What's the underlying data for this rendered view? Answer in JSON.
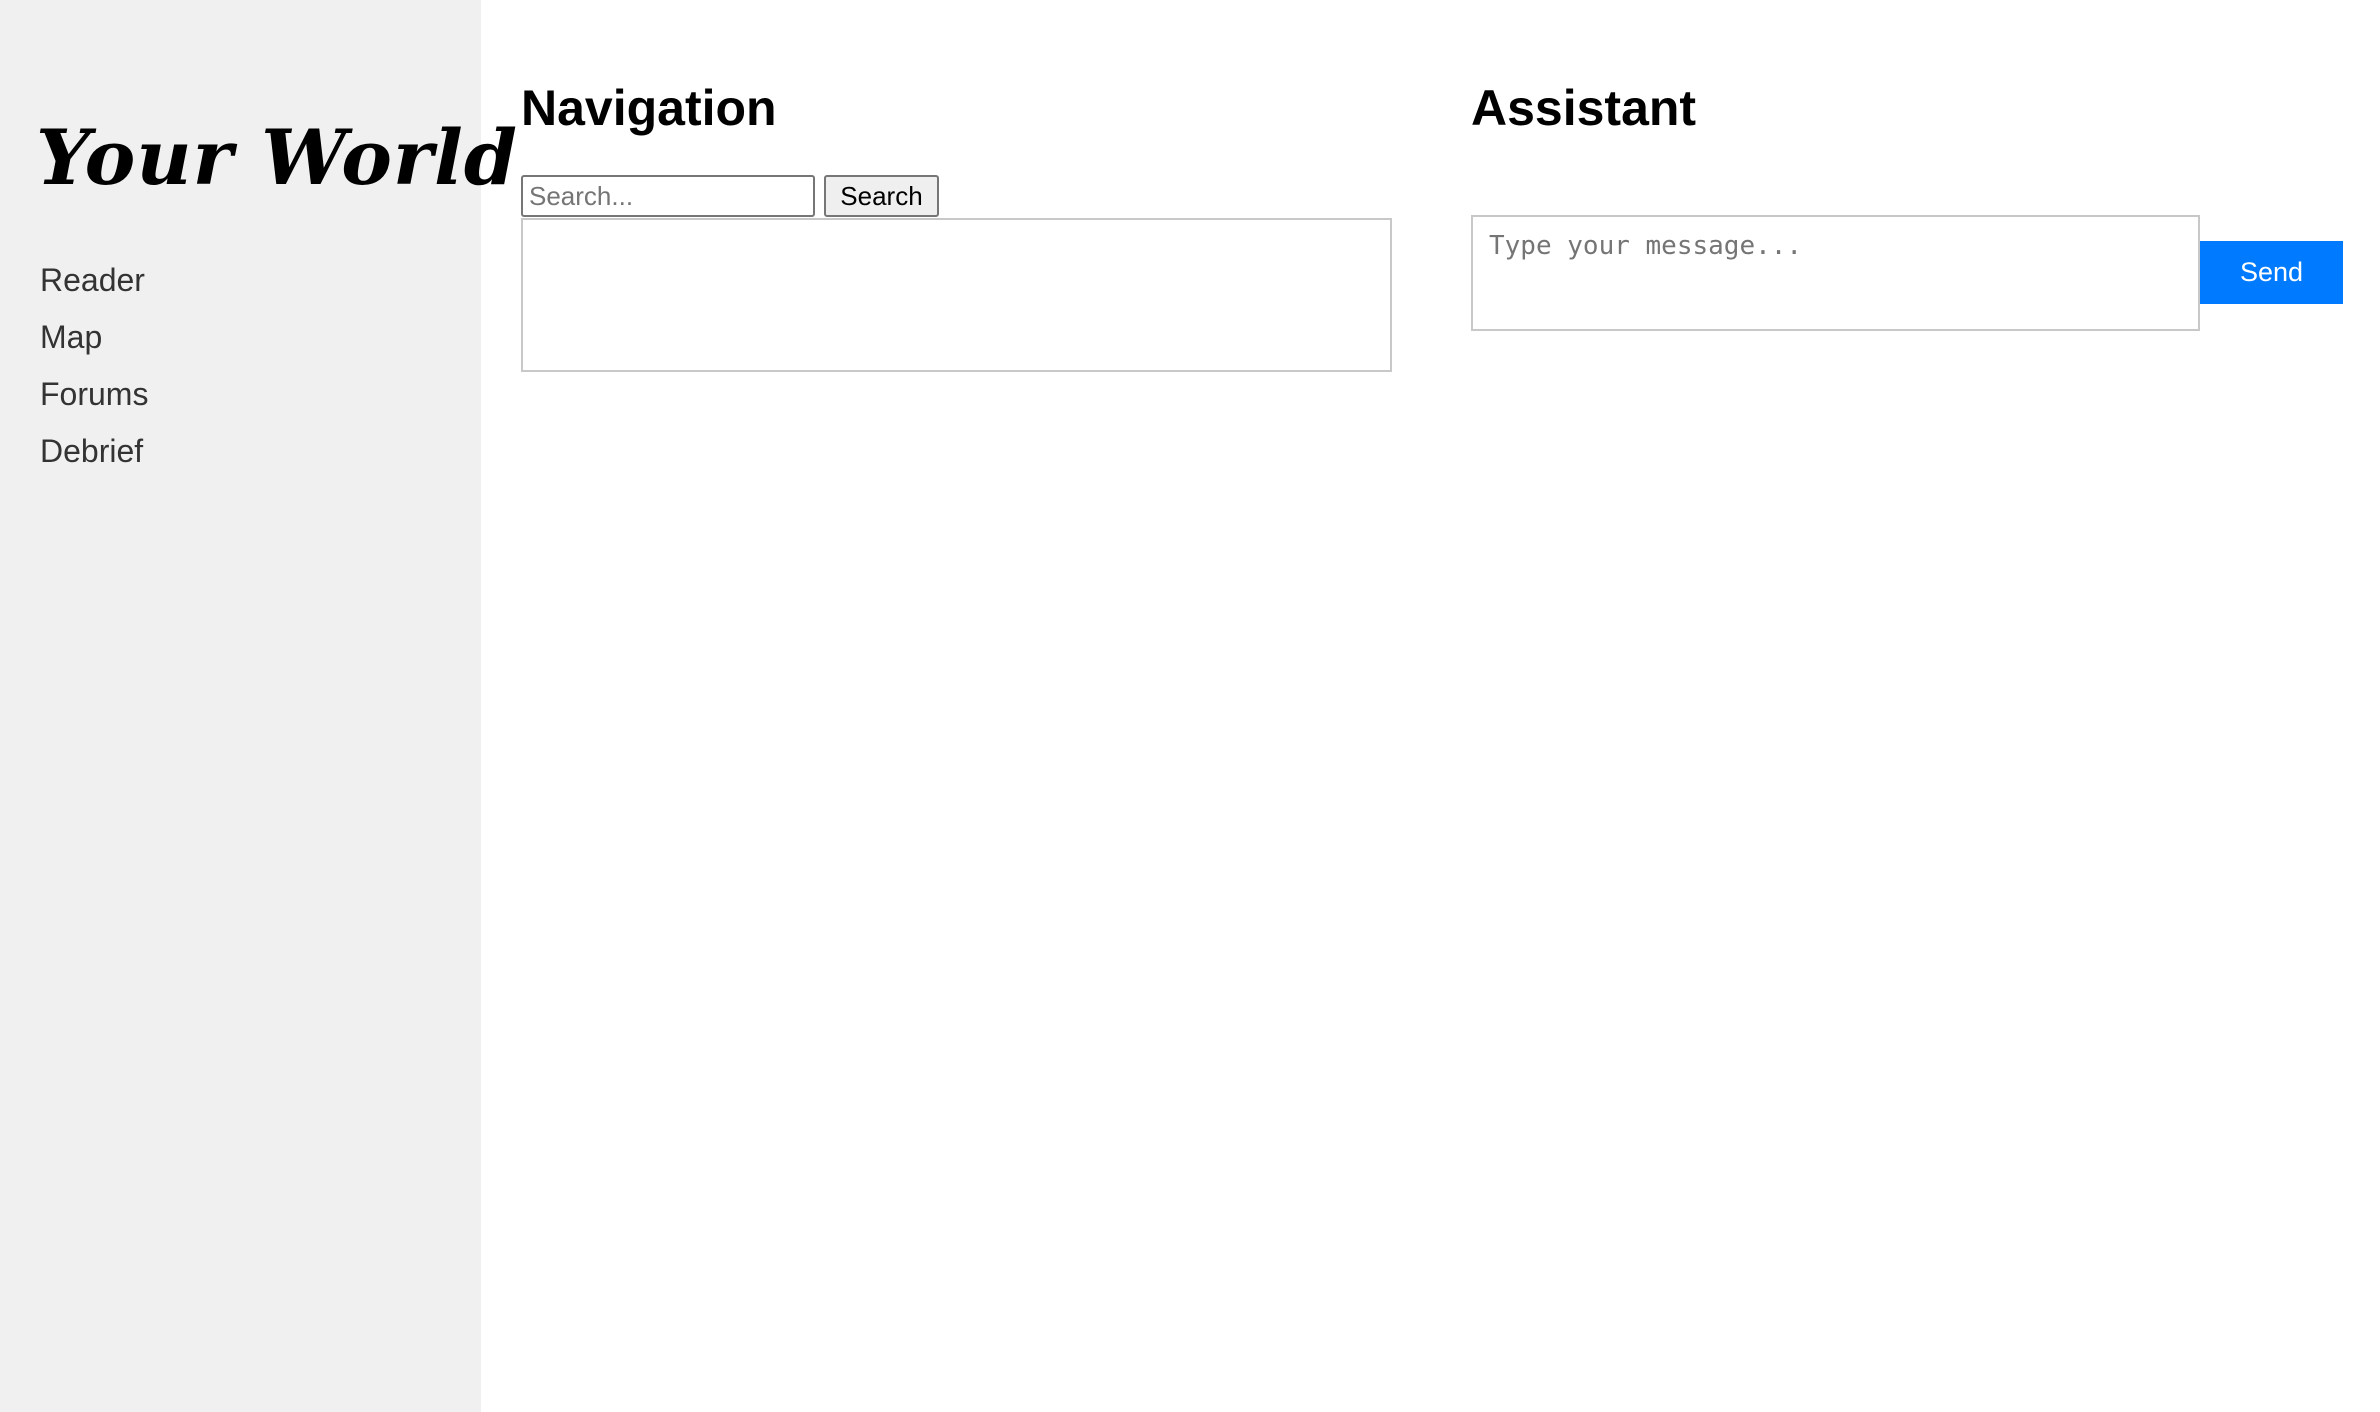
{
  "sidebar": {
    "logo": "Your World",
    "items": [
      {
        "label": "Reader"
      },
      {
        "label": "Map"
      },
      {
        "label": "Forums"
      },
      {
        "label": "Debrief"
      }
    ]
  },
  "navigation": {
    "title": "Navigation",
    "search": {
      "placeholder": "Search...",
      "value": "",
      "button_label": "Search"
    }
  },
  "assistant": {
    "title": "Assistant",
    "message": {
      "placeholder": "Type your message...",
      "value": ""
    },
    "send_label": "Send",
    "send_color": "#007bff"
  }
}
